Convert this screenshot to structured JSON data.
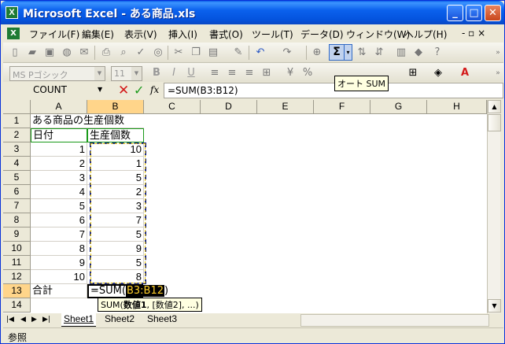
{
  "window": {
    "title": "Microsoft Excel - ある商品.xls",
    "minimize": "_",
    "maximize": "□",
    "close": "✕"
  },
  "menu": {
    "items": [
      "ファイル(F)",
      "編集(E)",
      "表示(V)",
      "挿入(I)",
      "書式(O)",
      "ツール(T)",
      "データ(D)",
      "ウィンドウ(W)",
      "ヘルプ(H)"
    ],
    "window_controls": "- ▫ ×"
  },
  "toolbar": {
    "autosum_label": "Σ",
    "autosum_tooltip": "オート SUM",
    "font_name": "MS Pゴシック",
    "font_size": "11"
  },
  "formula_bar": {
    "name_box": "COUNT",
    "fx": "fx",
    "formula": "=SUM(B3:B12)"
  },
  "grid": {
    "columns": [
      "A",
      "B",
      "C",
      "D",
      "E",
      "F",
      "G",
      "H"
    ],
    "rows": [
      "1",
      "2",
      "3",
      "4",
      "5",
      "6",
      "7",
      "8",
      "9",
      "10",
      "11",
      "12",
      "13",
      "14"
    ],
    "a1": "ある商品の生産個数",
    "a2": "日付",
    "b2": "生産個数",
    "dates": [
      "1",
      "2",
      "3",
      "4",
      "5",
      "6",
      "7",
      "8",
      "9",
      "10"
    ],
    "counts": [
      "10",
      "1",
      "5",
      "2",
      "3",
      "7",
      "5",
      "9",
      "5",
      "8"
    ],
    "a13": "合計",
    "b13_prefix": "=SUM(",
    "b13_range": "B3:B12",
    "b13_suffix": ")",
    "arg_tip_func": "SUM(",
    "arg_tip_bold": "数値1",
    "arg_tip_rest": ", [数値2], ...)"
  },
  "sheets": [
    "Sheet1",
    "Sheet2",
    "Sheet3"
  ],
  "status": "参照"
}
